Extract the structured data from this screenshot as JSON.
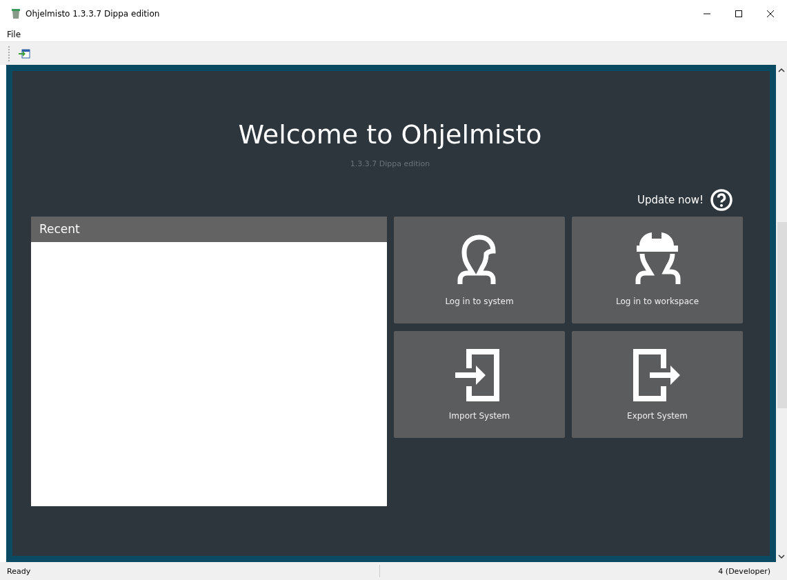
{
  "window": {
    "title": "Ohjelmisto 1.3.3.7 Dippa edition"
  },
  "menu": [
    "File"
  ],
  "welcome": {
    "title": "Welcome to Ohjelmisto",
    "version": "1.3.3.7 Dippa edition",
    "update_link": "Update now!"
  },
  "recent": {
    "title": "Recent"
  },
  "tiles": [
    {
      "kind": "user",
      "label": "Log in to system"
    },
    {
      "kind": "worker",
      "label": "Log in to workspace"
    },
    {
      "kind": "import",
      "label": "Import System"
    },
    {
      "kind": "export",
      "label": "Export System"
    }
  ],
  "status_bar": {
    "left": "Ready",
    "right": "4 (Developer)"
  }
}
